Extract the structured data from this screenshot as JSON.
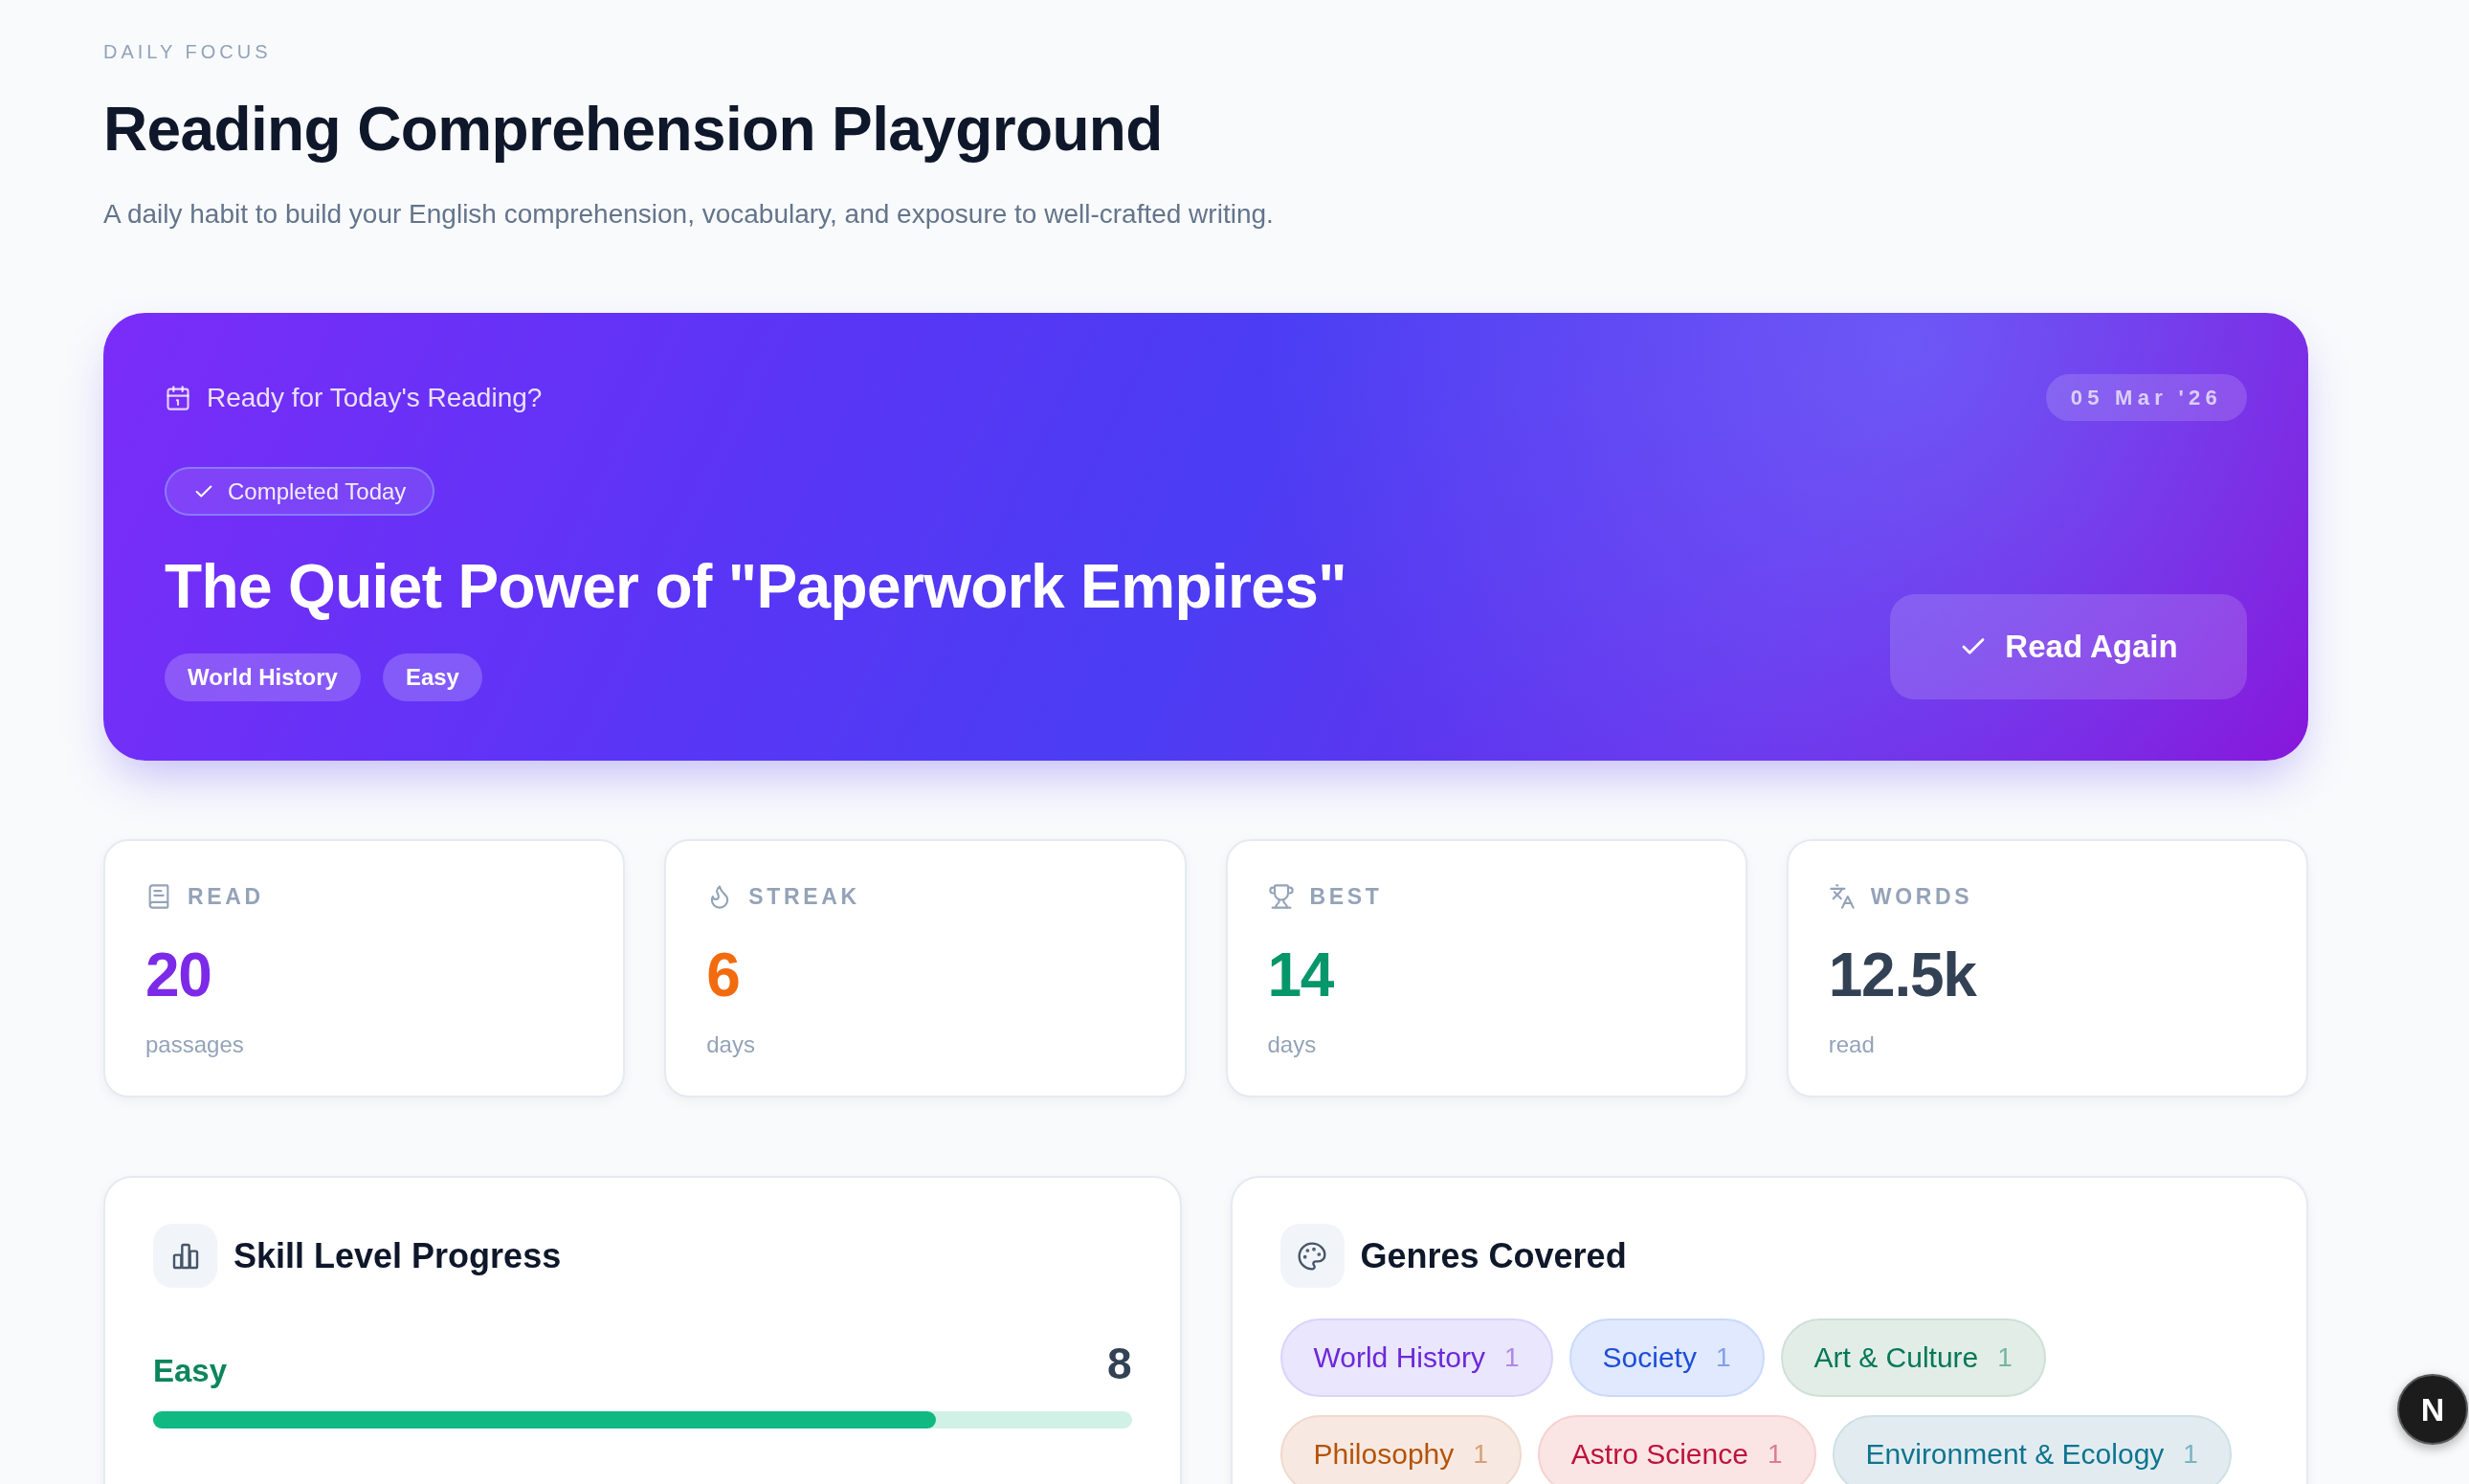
{
  "header": {
    "eyebrow": "DAILY FOCUS",
    "title": "Reading Comprehension Playground",
    "subtitle": "A daily habit to build your English comprehension, vocabulary, and exposure to well-crafted writing."
  },
  "today": {
    "prompt": "Ready for Today's Reading?",
    "date": "05 Mar '26",
    "completed": true,
    "status": "Completed Today",
    "title": "The Quiet Power of \"Paperwork Empires\"",
    "tags": [
      "World History",
      "Easy"
    ],
    "action": "Read Again"
  },
  "stats": [
    {
      "kind": "read",
      "label": "READ",
      "value": "20",
      "unit": "passages",
      "color": "#7c2ae8"
    },
    {
      "kind": "streak",
      "label": "STREAK",
      "value": "6",
      "unit": "days",
      "color": "#f26b0f"
    },
    {
      "kind": "best",
      "label": "BEST",
      "value": "14",
      "unit": "days",
      "color": "#059669"
    },
    {
      "kind": "words",
      "label": "WORDS",
      "value": "12.5k",
      "unit": "read",
      "color": "#334155"
    }
  ],
  "skill_levels": {
    "title": "Skill Level Progress",
    "levels": [
      {
        "label": "Easy",
        "count": "8",
        "level": 0.8,
        "color": "#10b981"
      }
    ]
  },
  "genres": {
    "title": "Genres Covered",
    "items": [
      {
        "name": "World History",
        "count": "1",
        "color": "#6d28d9"
      },
      {
        "name": "Society",
        "count": "1",
        "color": "#1d4ed8"
      },
      {
        "name": "Art & Culture",
        "count": "1",
        "color": "#047857"
      },
      {
        "name": "Philosophy",
        "count": "1",
        "color": "#b45309"
      },
      {
        "name": "Astro Science",
        "count": "1",
        "color": "#be123c"
      },
      {
        "name": "Environment & Ecology",
        "count": "1",
        "color": "#0e7490"
      }
    ]
  },
  "dev_indicator": {
    "label": "N"
  }
}
